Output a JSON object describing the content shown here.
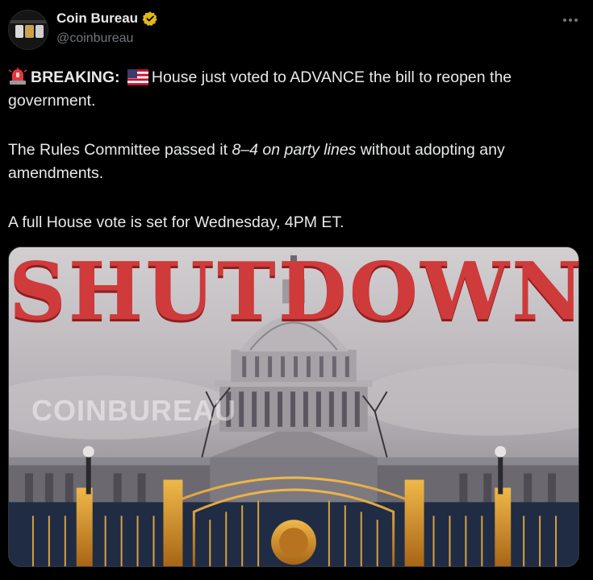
{
  "author": {
    "display_name": "Coin Bureau",
    "handle": "@coinbureau",
    "verified_icon": "gold-verified-badge-icon"
  },
  "tweet": {
    "line1_bold": "BREAKING:",
    "line1_rest": "House just voted to ADVANCE the bill to reopen the government.",
    "line2_a": "The Rules Committee passed it ",
    "line2_italic": "8–4 on party lines",
    "line2_b": " without adopting any amendments.",
    "line3": "A full House vote is set for Wednesday, 4PM ET.",
    "emojis": [
      "police-light-emoji",
      "us-flag-emoji"
    ]
  },
  "media": {
    "headline": "SHUTDOWN",
    "watermark": "COINBUREAU",
    "subject": "capitol-building-with-gold-gate"
  },
  "colors": {
    "background": "#000000",
    "text": "#e7e9ea",
    "muted": "#71767b",
    "verified_gold": "#e2b719",
    "headline_red": "#cf3a3a"
  }
}
